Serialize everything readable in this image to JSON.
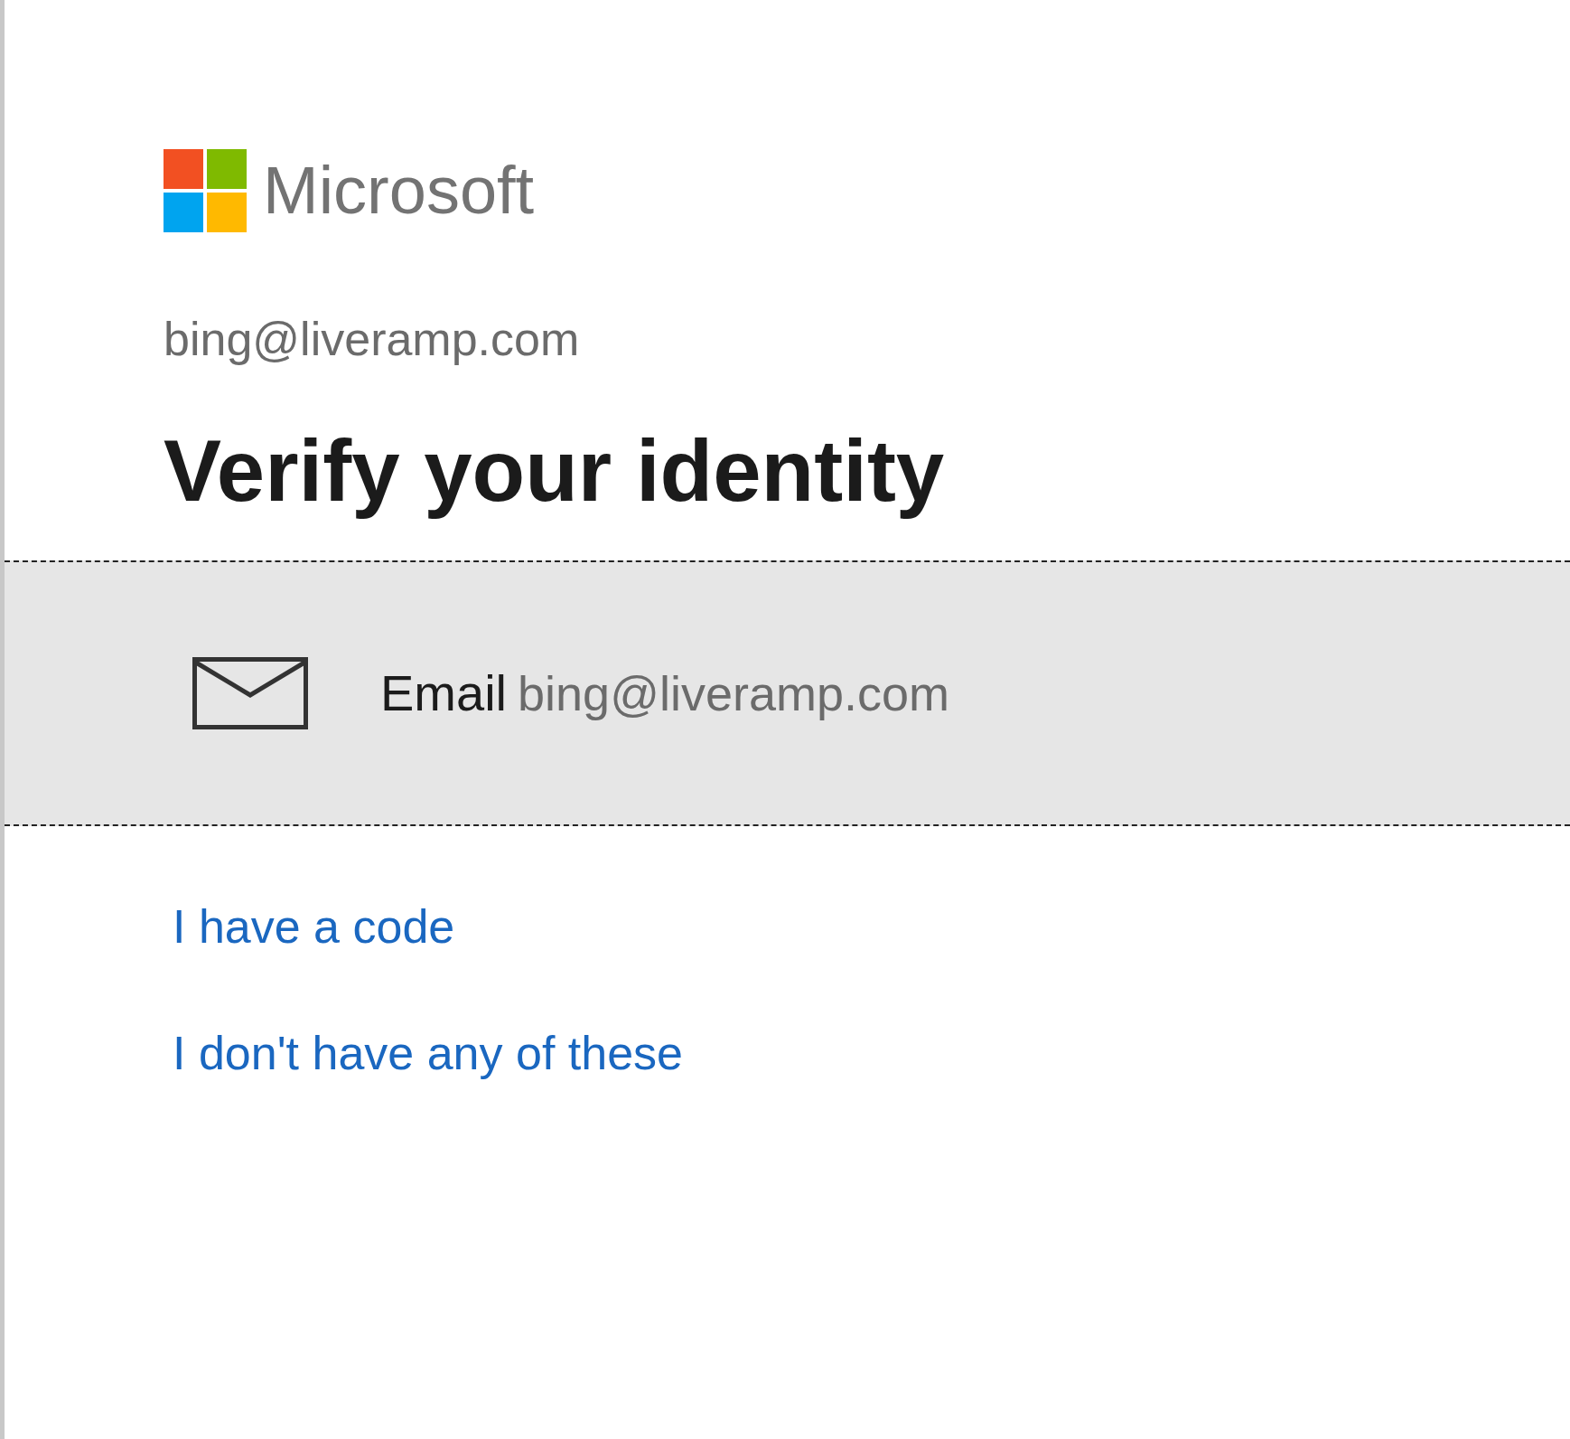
{
  "brand": {
    "name": "Microsoft"
  },
  "account": "bing@liveramp.com",
  "title": "Verify your identity",
  "options": [
    {
      "kind": "email",
      "label": "Email",
      "value": "bing@liveramp.com"
    }
  ],
  "links": [
    "I have a code",
    "I don't have any of these"
  ]
}
